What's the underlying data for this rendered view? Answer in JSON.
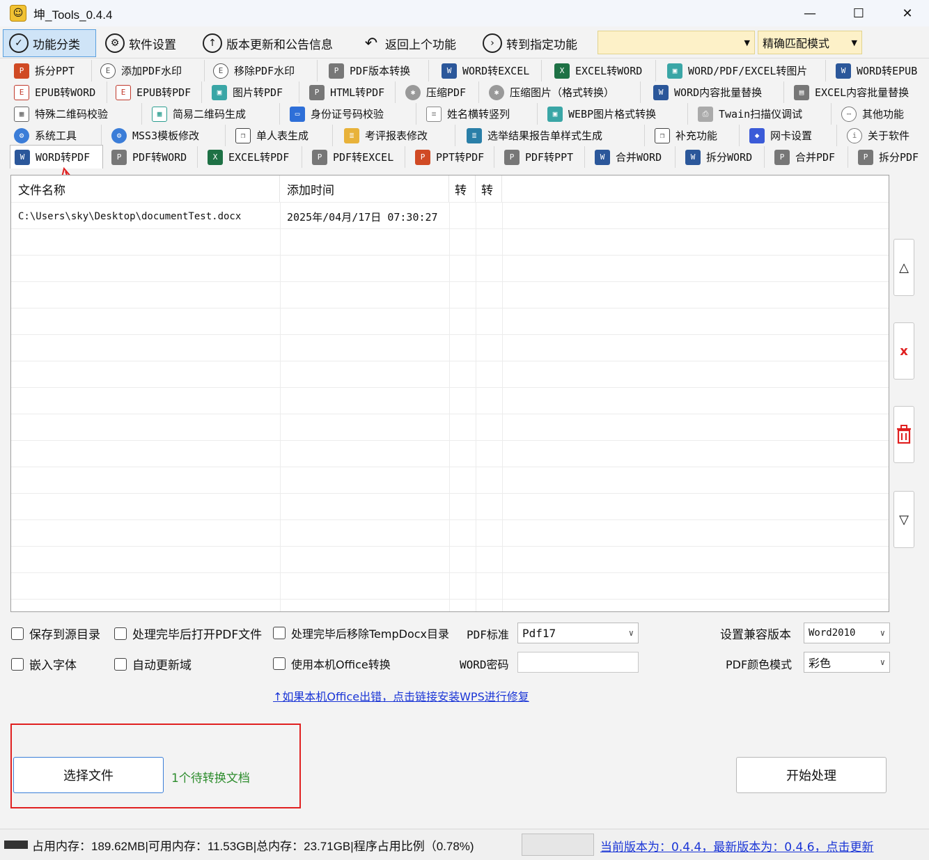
{
  "window": {
    "title": "坤_Tools_0.4.4",
    "minimize": "—",
    "maximize": "☐",
    "close": "✕"
  },
  "toolbar": {
    "categories": "功能分类",
    "settings": "软件设置",
    "updates": "版本更新和公告信息",
    "back": "返回上个功能",
    "goto": "转到指定功能",
    "search_value": "",
    "match_mode": "精确匹配模式"
  },
  "tabs": {
    "row1": [
      "拆分PPT",
      "添加PDF水印",
      "移除PDF水印",
      "PDF版本转换",
      "WORD转EXCEL",
      "EXCEL转WORD",
      "WORD/PDF/EXCEL转图片",
      "WORD转EPUB"
    ],
    "row2": [
      "EPUB转WORD",
      "EPUB转PDF",
      "图片转PDF",
      "HTML转PDF",
      "压缩PDF",
      "压缩图片（格式转换）",
      "WORD内容批量替换",
      "EXCEL内容批量替换"
    ],
    "row3": [
      "特殊二维码校验",
      "简易二维码生成",
      "身份证号码校验",
      "姓名横转竖列",
      "WEBP图片格式转换",
      "Twain扫描仪调试",
      "其他功能"
    ],
    "row4": [
      "系统工具",
      "MSS3模板修改",
      "单人表生成",
      "考评报表修改",
      "选举结果报告单样式生成",
      "补充功能",
      "网卡设置",
      "关于软件"
    ],
    "row5": [
      "WORD转PDF",
      "PDF转WORD",
      "EXCEL转PDF",
      "PDF转EXCEL",
      "PPT转PDF",
      "PDF转PPT",
      "合并WORD",
      "拆分WORD",
      "合并PDF",
      "拆分PDF"
    ]
  },
  "filelist": {
    "headers": [
      "文件名称",
      "添加时间",
      "转",
      "转"
    ],
    "rows": [
      [
        "C:\\Users\\sky\\Desktop\\documentTest.docx",
        "2025年/04月/17日 07:30:27",
        "",
        ""
      ]
    ]
  },
  "side_buttons": {
    "up": "△",
    "remove": "x",
    "clear": "🗑",
    "down": "▽"
  },
  "options": {
    "save_to_source": "保存到源目录",
    "open_pdf_after": "处理完毕后打开PDF文件",
    "remove_temp": "处理完毕后移除TempDocx目录",
    "pdf_standard_label": "PDF标准",
    "pdf_standard_value": "Pdf17",
    "compat_label": "设置兼容版本",
    "compat_value": "Word2010",
    "embed_fonts": "嵌入字体",
    "auto_update_fields": "自动更新域",
    "use_local_office": "使用本机Office转换",
    "word_password_label": "WORD密码",
    "word_password_value": "",
    "color_mode_label": "PDF颜色模式",
    "color_mode_value": "彩色",
    "repair_link": "↑如果本机Office出错，点击链接安装WPS进行修复"
  },
  "actions": {
    "select_file": "选择文件",
    "pending": "1个待转换文档",
    "start": "开始处理"
  },
  "status": {
    "memory": "占用内存：189.62MB|可用内存：11.53GB|总内存：23.71GB|程序占用比例（0.78%)",
    "version": "当前版本为：0.4.4，最新版本为：0.4.6，点击更新"
  }
}
